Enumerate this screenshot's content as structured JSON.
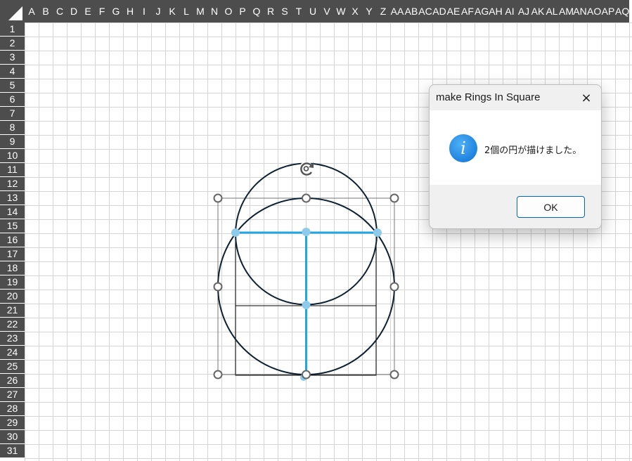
{
  "spreadsheet": {
    "columns": [
      "A",
      "B",
      "C",
      "D",
      "E",
      "F",
      "G",
      "H",
      "I",
      "J",
      "K",
      "L",
      "M",
      "N",
      "O",
      "P",
      "Q",
      "R",
      "S",
      "T",
      "U",
      "V",
      "W",
      "X",
      "Y",
      "Z",
      "AA",
      "AB",
      "AC",
      "AD",
      "AE",
      "AF",
      "AG",
      "AH",
      "AI",
      "AJ",
      "AK",
      "AL",
      "AM",
      "AN",
      "AO",
      "AP",
      "AQ"
    ],
    "rows": [
      "1",
      "2",
      "3",
      "4",
      "5",
      "6",
      "7",
      "8",
      "9",
      "10",
      "11",
      "12",
      "13",
      "14",
      "15",
      "16",
      "17",
      "18",
      "19",
      "20",
      "21",
      "22",
      "23",
      "24",
      "25",
      "26",
      "27",
      "28",
      "29",
      "30",
      "31"
    ],
    "colors": {
      "header_bg": "#4d4d4d",
      "header_text": "#ffffff",
      "gridline": "#d4d4d4"
    }
  },
  "drawing": {
    "circles_drawn": 2,
    "colors": {
      "circle_stroke": "#0d2133",
      "guide_line": "#1ea7e1",
      "guide_point": "#8ecbea",
      "square_stroke": "#000000",
      "handle_stroke": "#666666"
    },
    "icons": {
      "rotate_handle": "rotate-arrow-icon",
      "resize_handle": "circle-handle-icon"
    }
  },
  "dialog": {
    "title": "make Rings In Square",
    "close_icon": "×",
    "message": "2個の円が描けました。",
    "info_icon_glyph": "i",
    "ok_label": "OK",
    "colors": {
      "info_icon": "#1a84e3",
      "ok_border": "#0067c0"
    }
  }
}
